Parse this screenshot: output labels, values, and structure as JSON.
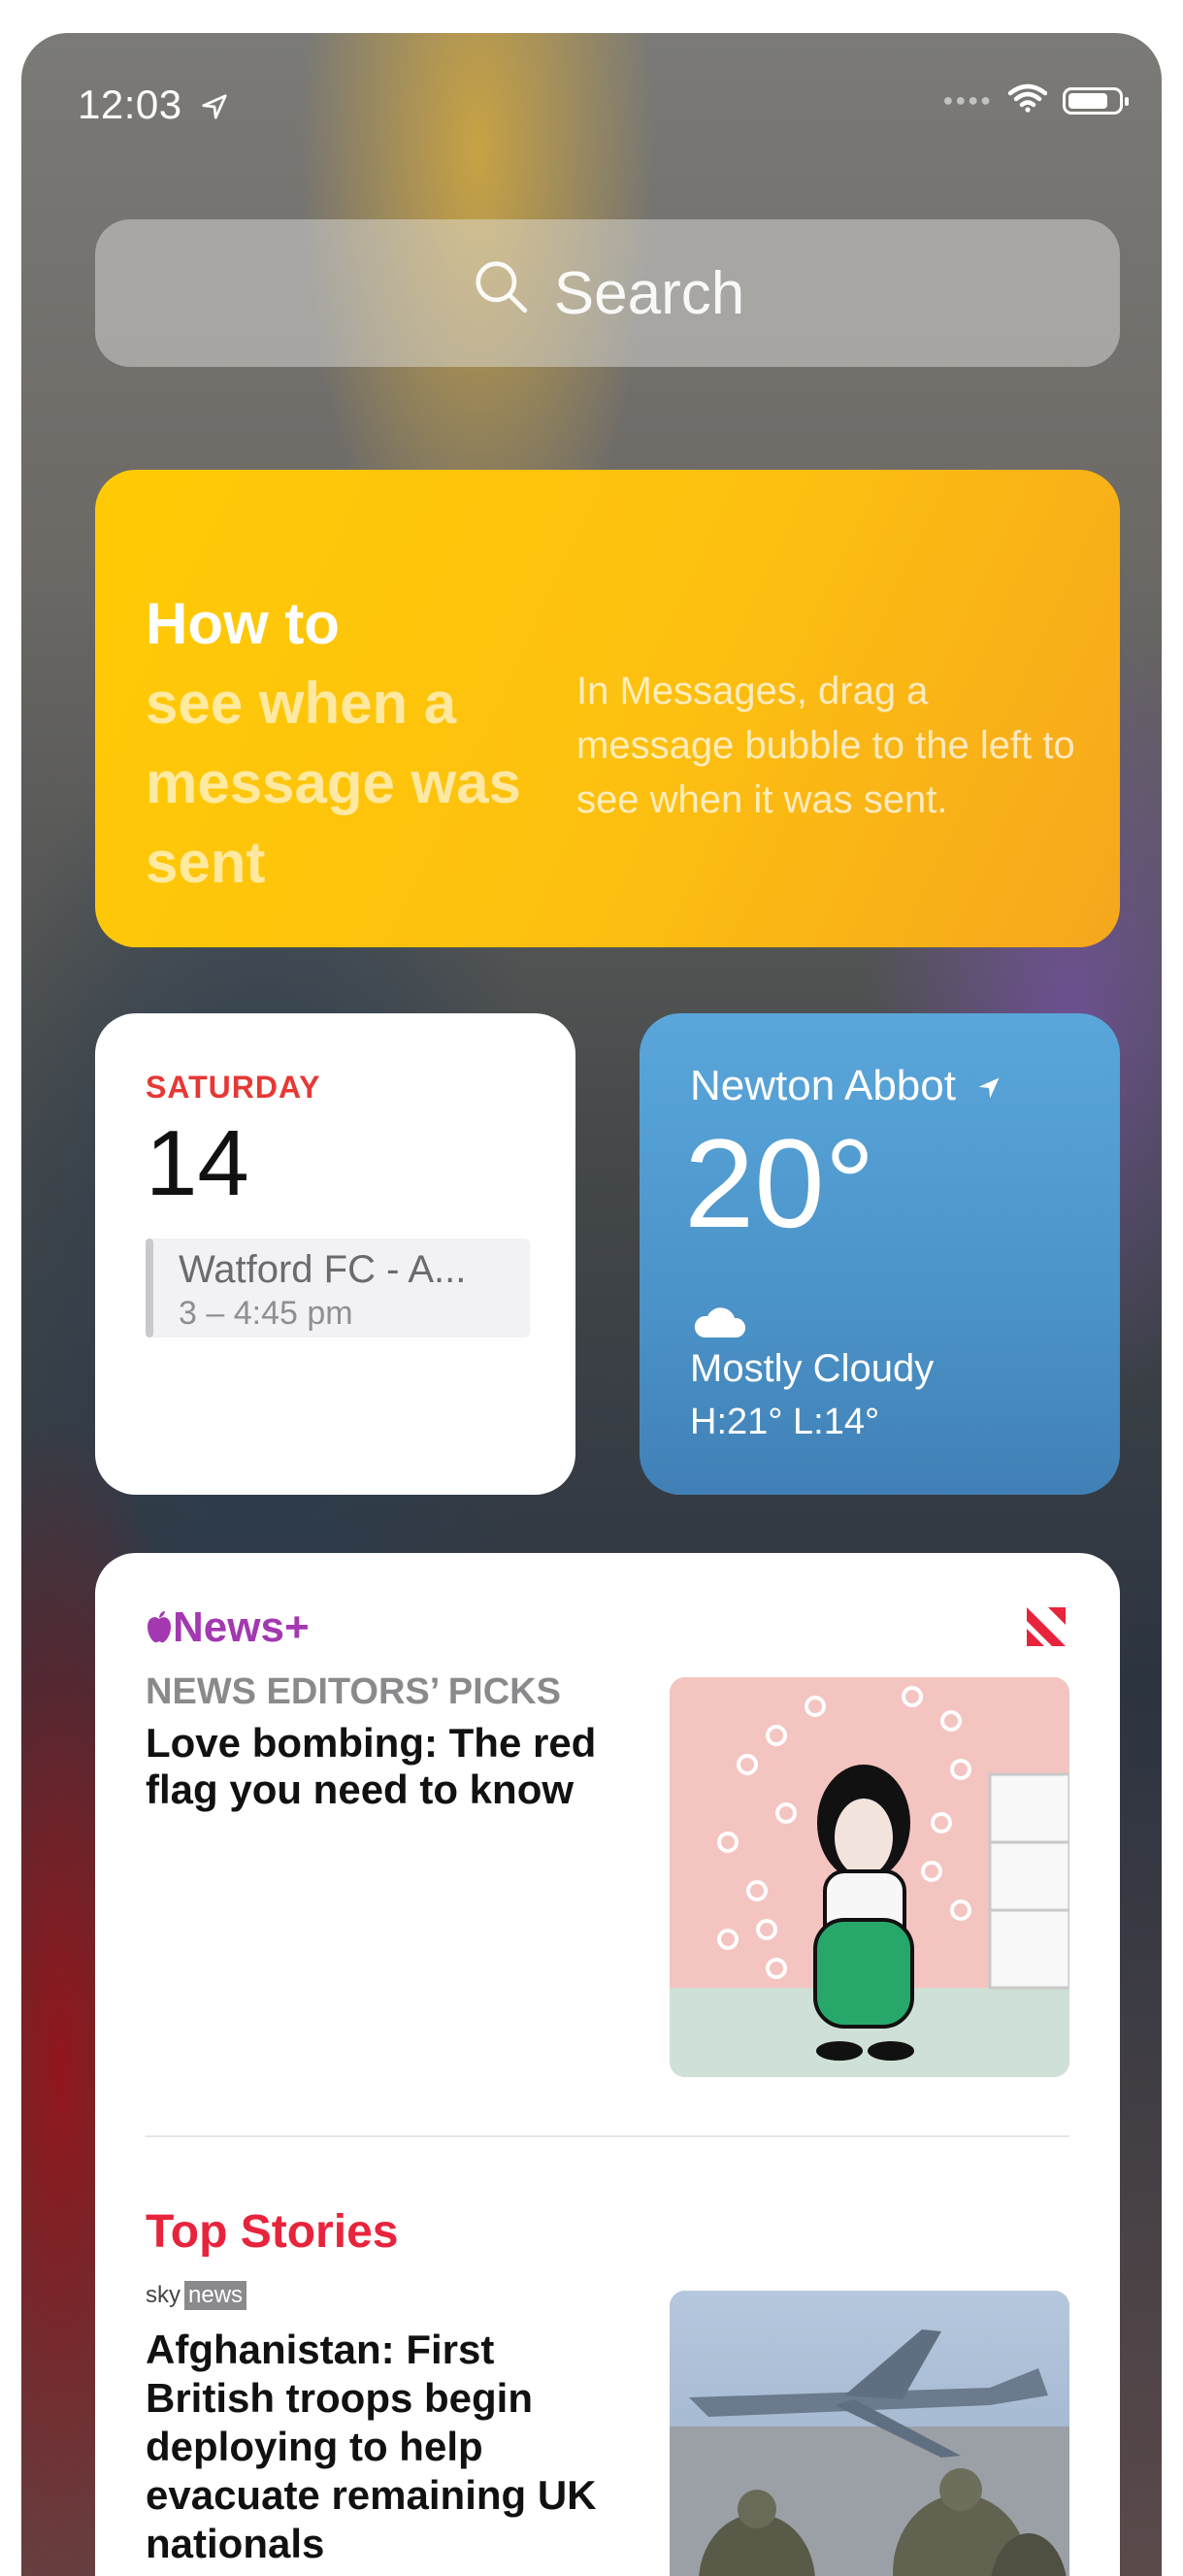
{
  "status_bar": {
    "time": "12:03",
    "location_icon": "location-arrow-icon",
    "wifi_icon": "wifi-icon",
    "battery_icon": "battery-icon"
  },
  "search": {
    "placeholder": "Search",
    "icon": "search-icon"
  },
  "tips_widget": {
    "title_lead": "How to",
    "title_rest": "see when a message was sent",
    "body": "In Messages, drag a message bubble to the left to see when it was sent.",
    "accent": "#ffcb05"
  },
  "calendar_widget": {
    "day_name": "SATURDAY",
    "date": "14",
    "event_name": "Watford FC - A...",
    "event_time": "3 – 4:45 pm",
    "accent": "#e53935"
  },
  "weather_widget": {
    "city": "Newton Abbot",
    "temperature": "20°",
    "condition_icon": "cloud-icon",
    "condition": "Mostly Cloudy",
    "high_low": "H:21° L:14°"
  },
  "news_widget": {
    "brand": "News+",
    "brand_icon": "apple-icon",
    "logo_icon": "apple-news-icon",
    "section": "NEWS EDITORS’ PICKS",
    "headline": "Love bombing: The red flag you need to know",
    "top_stories_label": "Top Stories",
    "source_part1": "sky",
    "source_part2": "news",
    "top_headline": "Afghanistan: First British troops begin deploying to help evacuate remaining UK nationals",
    "accent_top": "#e8243c",
    "accent_brand": "#a338b0"
  }
}
